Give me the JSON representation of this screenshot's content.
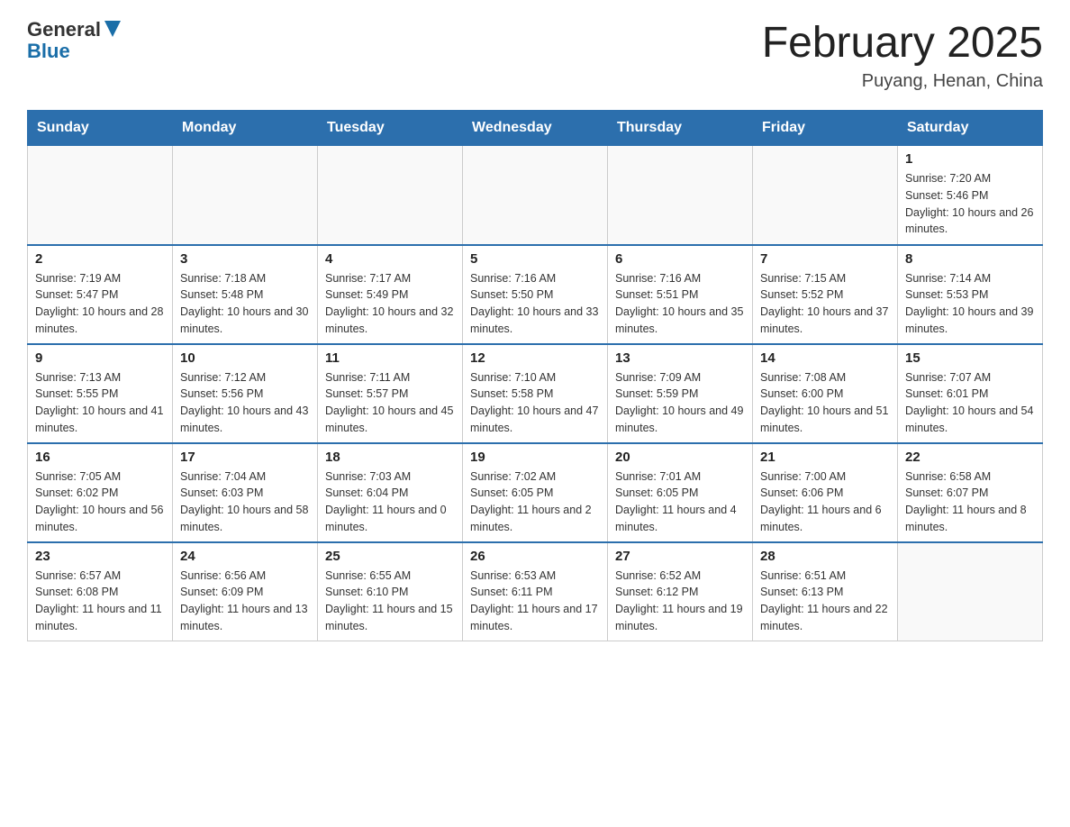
{
  "header": {
    "logo_general": "General",
    "logo_blue": "Blue",
    "title": "February 2025",
    "subtitle": "Puyang, Henan, China"
  },
  "days_of_week": [
    "Sunday",
    "Monday",
    "Tuesday",
    "Wednesday",
    "Thursday",
    "Friday",
    "Saturday"
  ],
  "weeks": [
    [
      {
        "date": "",
        "info": ""
      },
      {
        "date": "",
        "info": ""
      },
      {
        "date": "",
        "info": ""
      },
      {
        "date": "",
        "info": ""
      },
      {
        "date": "",
        "info": ""
      },
      {
        "date": "",
        "info": ""
      },
      {
        "date": "1",
        "info": "Sunrise: 7:20 AM\nSunset: 5:46 PM\nDaylight: 10 hours and 26 minutes."
      }
    ],
    [
      {
        "date": "2",
        "info": "Sunrise: 7:19 AM\nSunset: 5:47 PM\nDaylight: 10 hours and 28 minutes."
      },
      {
        "date": "3",
        "info": "Sunrise: 7:18 AM\nSunset: 5:48 PM\nDaylight: 10 hours and 30 minutes."
      },
      {
        "date": "4",
        "info": "Sunrise: 7:17 AM\nSunset: 5:49 PM\nDaylight: 10 hours and 32 minutes."
      },
      {
        "date": "5",
        "info": "Sunrise: 7:16 AM\nSunset: 5:50 PM\nDaylight: 10 hours and 33 minutes."
      },
      {
        "date": "6",
        "info": "Sunrise: 7:16 AM\nSunset: 5:51 PM\nDaylight: 10 hours and 35 minutes."
      },
      {
        "date": "7",
        "info": "Sunrise: 7:15 AM\nSunset: 5:52 PM\nDaylight: 10 hours and 37 minutes."
      },
      {
        "date": "8",
        "info": "Sunrise: 7:14 AM\nSunset: 5:53 PM\nDaylight: 10 hours and 39 minutes."
      }
    ],
    [
      {
        "date": "9",
        "info": "Sunrise: 7:13 AM\nSunset: 5:55 PM\nDaylight: 10 hours and 41 minutes."
      },
      {
        "date": "10",
        "info": "Sunrise: 7:12 AM\nSunset: 5:56 PM\nDaylight: 10 hours and 43 minutes."
      },
      {
        "date": "11",
        "info": "Sunrise: 7:11 AM\nSunset: 5:57 PM\nDaylight: 10 hours and 45 minutes."
      },
      {
        "date": "12",
        "info": "Sunrise: 7:10 AM\nSunset: 5:58 PM\nDaylight: 10 hours and 47 minutes."
      },
      {
        "date": "13",
        "info": "Sunrise: 7:09 AM\nSunset: 5:59 PM\nDaylight: 10 hours and 49 minutes."
      },
      {
        "date": "14",
        "info": "Sunrise: 7:08 AM\nSunset: 6:00 PM\nDaylight: 10 hours and 51 minutes."
      },
      {
        "date": "15",
        "info": "Sunrise: 7:07 AM\nSunset: 6:01 PM\nDaylight: 10 hours and 54 minutes."
      }
    ],
    [
      {
        "date": "16",
        "info": "Sunrise: 7:05 AM\nSunset: 6:02 PM\nDaylight: 10 hours and 56 minutes."
      },
      {
        "date": "17",
        "info": "Sunrise: 7:04 AM\nSunset: 6:03 PM\nDaylight: 10 hours and 58 minutes."
      },
      {
        "date": "18",
        "info": "Sunrise: 7:03 AM\nSunset: 6:04 PM\nDaylight: 11 hours and 0 minutes."
      },
      {
        "date": "19",
        "info": "Sunrise: 7:02 AM\nSunset: 6:05 PM\nDaylight: 11 hours and 2 minutes."
      },
      {
        "date": "20",
        "info": "Sunrise: 7:01 AM\nSunset: 6:05 PM\nDaylight: 11 hours and 4 minutes."
      },
      {
        "date": "21",
        "info": "Sunrise: 7:00 AM\nSunset: 6:06 PM\nDaylight: 11 hours and 6 minutes."
      },
      {
        "date": "22",
        "info": "Sunrise: 6:58 AM\nSunset: 6:07 PM\nDaylight: 11 hours and 8 minutes."
      }
    ],
    [
      {
        "date": "23",
        "info": "Sunrise: 6:57 AM\nSunset: 6:08 PM\nDaylight: 11 hours and 11 minutes."
      },
      {
        "date": "24",
        "info": "Sunrise: 6:56 AM\nSunset: 6:09 PM\nDaylight: 11 hours and 13 minutes."
      },
      {
        "date": "25",
        "info": "Sunrise: 6:55 AM\nSunset: 6:10 PM\nDaylight: 11 hours and 15 minutes."
      },
      {
        "date": "26",
        "info": "Sunrise: 6:53 AM\nSunset: 6:11 PM\nDaylight: 11 hours and 17 minutes."
      },
      {
        "date": "27",
        "info": "Sunrise: 6:52 AM\nSunset: 6:12 PM\nDaylight: 11 hours and 19 minutes."
      },
      {
        "date": "28",
        "info": "Sunrise: 6:51 AM\nSunset: 6:13 PM\nDaylight: 11 hours and 22 minutes."
      },
      {
        "date": "",
        "info": ""
      }
    ]
  ]
}
